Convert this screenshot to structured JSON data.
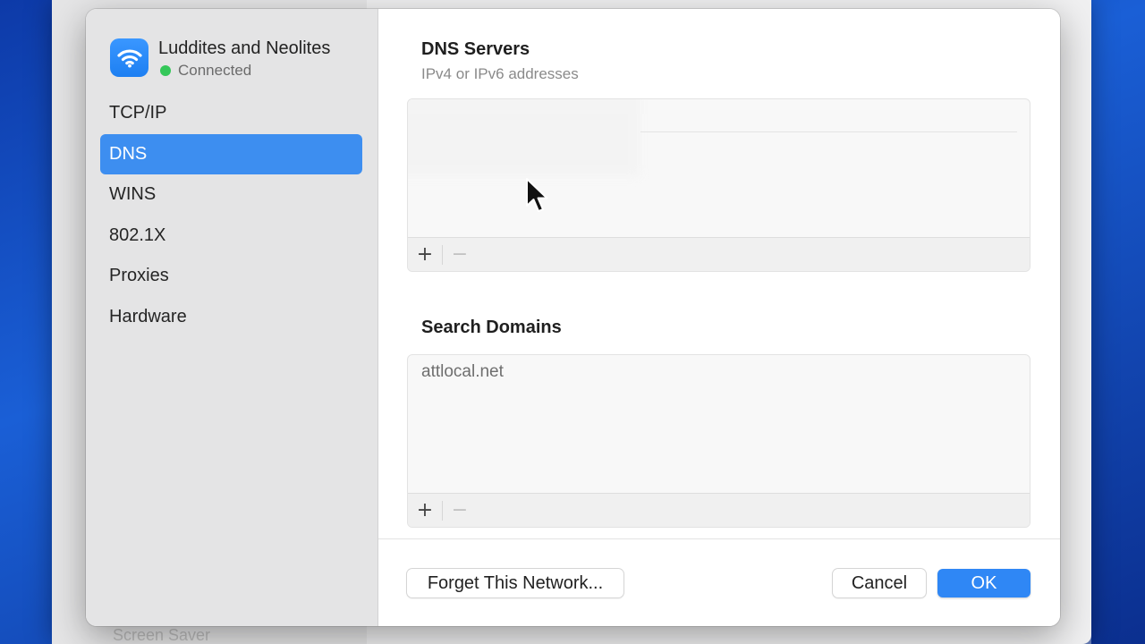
{
  "background": {
    "footer_label": "Screen Saver"
  },
  "network": {
    "name": "Luddites and Neolites",
    "status": "Connected",
    "status_color": "#34c759",
    "icon": "wifi-icon"
  },
  "sidebar": {
    "items": [
      {
        "label": "TCP/IP",
        "active": false
      },
      {
        "label": "DNS",
        "active": true
      },
      {
        "label": "WINS",
        "active": false
      },
      {
        "label": "802.1X",
        "active": false
      },
      {
        "label": "Proxies",
        "active": false
      },
      {
        "label": "Hardware",
        "active": false
      }
    ],
    "accent": "#3d8ef0"
  },
  "dns_servers": {
    "title": "DNS Servers",
    "subtitle": "IPv4 or IPv6 addresses",
    "entries": [],
    "add_label": "+",
    "remove_label": "−"
  },
  "search_domains": {
    "title": "Search Domains",
    "entries": [
      "attlocal.net"
    ],
    "add_label": "+",
    "remove_label": "−"
  },
  "footer": {
    "forget_label": "Forget This Network...",
    "cancel_label": "Cancel",
    "ok_label": "OK"
  }
}
